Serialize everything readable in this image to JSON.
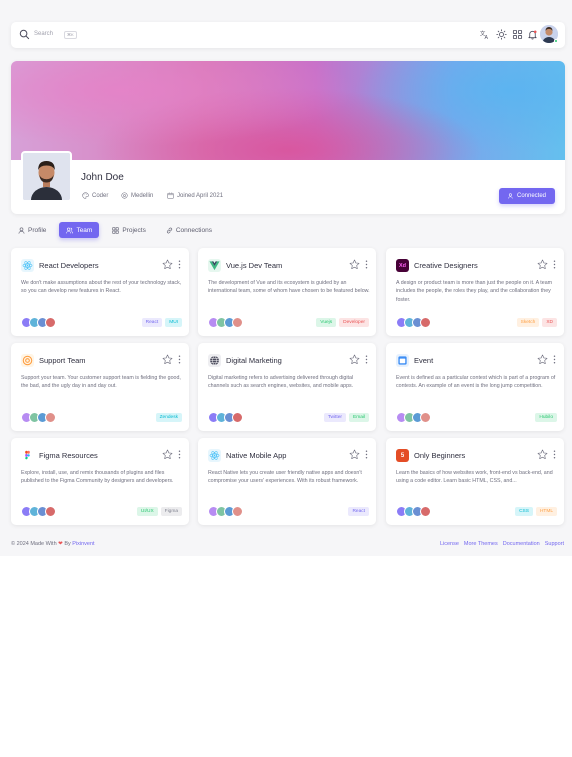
{
  "navbar": {
    "search_placeholder": "Search",
    "search_shortcut": "⌘K",
    "icons": [
      "translate-icon",
      "sun-icon",
      "grid-icon",
      "bell-icon"
    ]
  },
  "profile": {
    "name": "John Doe",
    "role": "Coder",
    "location": "Medellin",
    "joined": "Joined April 2021",
    "connected_label": "Connected"
  },
  "tabs": [
    {
      "label": "Profile",
      "active": false
    },
    {
      "label": "Team",
      "active": true
    },
    {
      "label": "Projects",
      "active": false
    },
    {
      "label": "Connections",
      "active": false
    }
  ],
  "teams": [
    {
      "title": "React Developers",
      "logo": "react-icon",
      "logo_color": "#e7f6fd",
      "description": "We don't make assumptions about the rest of your technology stack, so you can develop new features in React.",
      "chips": [
        {
          "label": "React",
          "color": "#7367f0",
          "bg": "#ebe9fd"
        },
        {
          "label": "MUI",
          "color": "#00bad1",
          "bg": "#d6f5f9"
        }
      ]
    },
    {
      "title": "Vue.js Dev Team",
      "logo": "vue-icon",
      "logo_color": "#e6f7ef",
      "description": "The development of Vue and its ecosystem is guided by an international team, some of whom have chosen to be featured below.",
      "chips": [
        {
          "label": "Vuejs",
          "color": "#28c76f",
          "bg": "#dcf6e8"
        },
        {
          "label": "Developer",
          "color": "#ea5455",
          "bg": "#fce4e4"
        }
      ]
    },
    {
      "title": "Creative Designers",
      "logo": "xd-icon",
      "logo_color": "#470137",
      "description": "A design or product team is more than just the people on it. A team includes the people, the roles they play, and the collaboration they foster.",
      "chips": [
        {
          "label": "Sketch",
          "color": "#ff9f43",
          "bg": "#fff0e1"
        },
        {
          "label": "XD",
          "color": "#ea5455",
          "bg": "#fce4e4"
        }
      ]
    },
    {
      "title": "Support Team",
      "logo": "support-icon",
      "logo_color": "#fff5e6",
      "description": "Support your team. Your customer support team is fielding the good, the bad, and the ugly day in and day out.",
      "chips": [
        {
          "label": "Zendesk",
          "color": "#00bad1",
          "bg": "#d6f5f9"
        }
      ]
    },
    {
      "title": "Digital Marketing",
      "logo": "globe-icon",
      "logo_color": "#eeeef1",
      "description": "Digital marketing refers to advertising delivered through digital channels such as search engines, websites, and mobile apps.",
      "chips": [
        {
          "label": "Twitter",
          "color": "#7367f0",
          "bg": "#ebe9fd"
        },
        {
          "label": "Email",
          "color": "#28c76f",
          "bg": "#dcf6e8"
        }
      ]
    },
    {
      "title": "Event",
      "logo": "event-icon",
      "logo_color": "#e7f1fd",
      "description": "Event is defined as a particular contest which is part of a program of contests. An example of an event is the long jump competition.",
      "chips": [
        {
          "label": "Hubilo",
          "color": "#28c76f",
          "bg": "#dcf6e8"
        }
      ]
    },
    {
      "title": "Figma Resources",
      "logo": "figma-icon",
      "logo_color": "#fff",
      "description": "Explore, install, use, and remix thousands of plugins and files published to the Figma Community by designers and developers.",
      "chips": [
        {
          "label": "UI/UX",
          "color": "#28c76f",
          "bg": "#dcf6e8"
        },
        {
          "label": "Figma",
          "color": "#808390",
          "bg": "#ececee"
        }
      ]
    },
    {
      "title": "Native Mobile App",
      "logo": "react-native-icon",
      "logo_color": "#e7f6fd",
      "description": "React Native lets you create user friendly native apps and doesn't compromise your users' experiences. With its robust framework.",
      "chips": [
        {
          "label": "React",
          "color": "#7367f0",
          "bg": "#ebe9fd"
        }
      ]
    },
    {
      "title": "Only Beginners",
      "logo": "html5-icon",
      "logo_color": "#e44d26",
      "description": "Learn the basics of how websites work, front-end vs back-end, and using a code editor. Learn basic HTML, CSS, and...",
      "chips": [
        {
          "label": "CSS",
          "color": "#00bad1",
          "bg": "#d6f5f9"
        },
        {
          "label": "HTML",
          "color": "#ff9f43",
          "bg": "#fff0e1"
        }
      ]
    }
  ],
  "footer": {
    "copyright_prefix": "© 2024 Made With",
    "by": "By",
    "brand": "Pixinvent",
    "links": [
      "License",
      "More Themes",
      "Documentation",
      "Support"
    ]
  }
}
